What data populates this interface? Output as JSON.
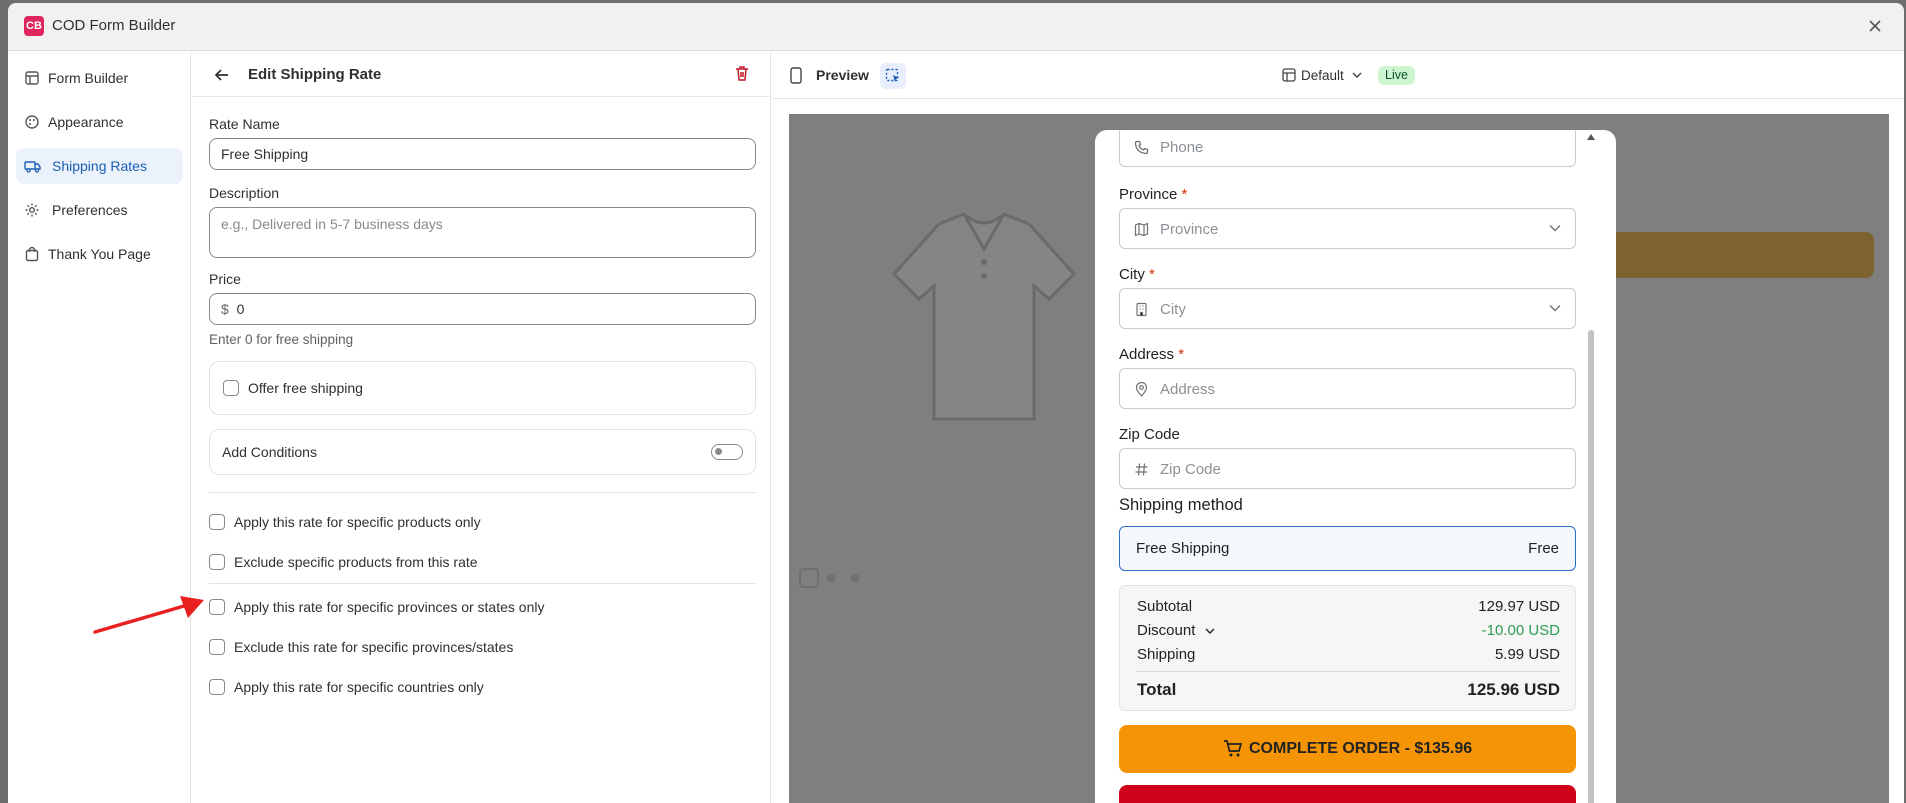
{
  "app": {
    "title": "COD Form Builder",
    "logo": "CB"
  },
  "nav": {
    "items": [
      {
        "label": "Form Builder",
        "icon": "form-builder-icon"
      },
      {
        "label": "Appearance",
        "icon": "palette-icon"
      },
      {
        "label": "Shipping Rates",
        "icon": "truck-icon"
      },
      {
        "label": "Preferences",
        "icon": "gear-icon"
      },
      {
        "label": "Thank You Page",
        "icon": "bag-icon"
      }
    ],
    "active": "Shipping Rates"
  },
  "editor": {
    "title": "Edit Shipping Rate",
    "rate_name_label": "Rate Name",
    "rate_name_value": "Free Shipping",
    "description_label": "Description",
    "description_placeholder": "e.g., Delivered in 5-7 business days",
    "price_label": "Price",
    "price_prefix": "$",
    "price_value": "0",
    "price_help": "Enter 0 for free shipping",
    "offer_free_label": "Offer free shipping",
    "add_conditions_label": "Add Conditions",
    "conditions": [
      "Apply this rate for specific products only",
      "Exclude specific products from this rate",
      "Apply this rate for specific provinces or states only",
      "Exclude this rate for specific provinces/states",
      "Apply this rate for specific countries only"
    ]
  },
  "preview": {
    "label": "Preview",
    "template": "Default",
    "status": "Live",
    "form": {
      "phone_placeholder": "Phone",
      "province_label": "Province",
      "province_placeholder": "Province",
      "city_label": "City",
      "city_placeholder": "City",
      "address_label": "Address",
      "address_placeholder": "Address",
      "zip_label": "Zip Code",
      "zip_placeholder": "Zip Code",
      "required_mark": "*",
      "shipping_method_title": "Shipping method",
      "shipping_option_name": "Free Shipping",
      "shipping_option_price": "Free",
      "subtotal_label": "Subtotal",
      "subtotal_value": "129.97 USD",
      "discount_label": "Discount",
      "discount_value": "-10.00 USD",
      "shipping_label": "Shipping",
      "shipping_value": "5.99 USD",
      "total_label": "Total",
      "total_value": "125.96 USD",
      "complete_button": "COMPLETE ORDER - $135.96"
    }
  },
  "colors": {
    "accent": "#1a5fb4",
    "order_button": "#f59505",
    "discount": "#2e9d52",
    "live_badge_bg": "#cdf5d0",
    "danger": "#d72c0d",
    "annotation_arrow": "#e82020"
  }
}
